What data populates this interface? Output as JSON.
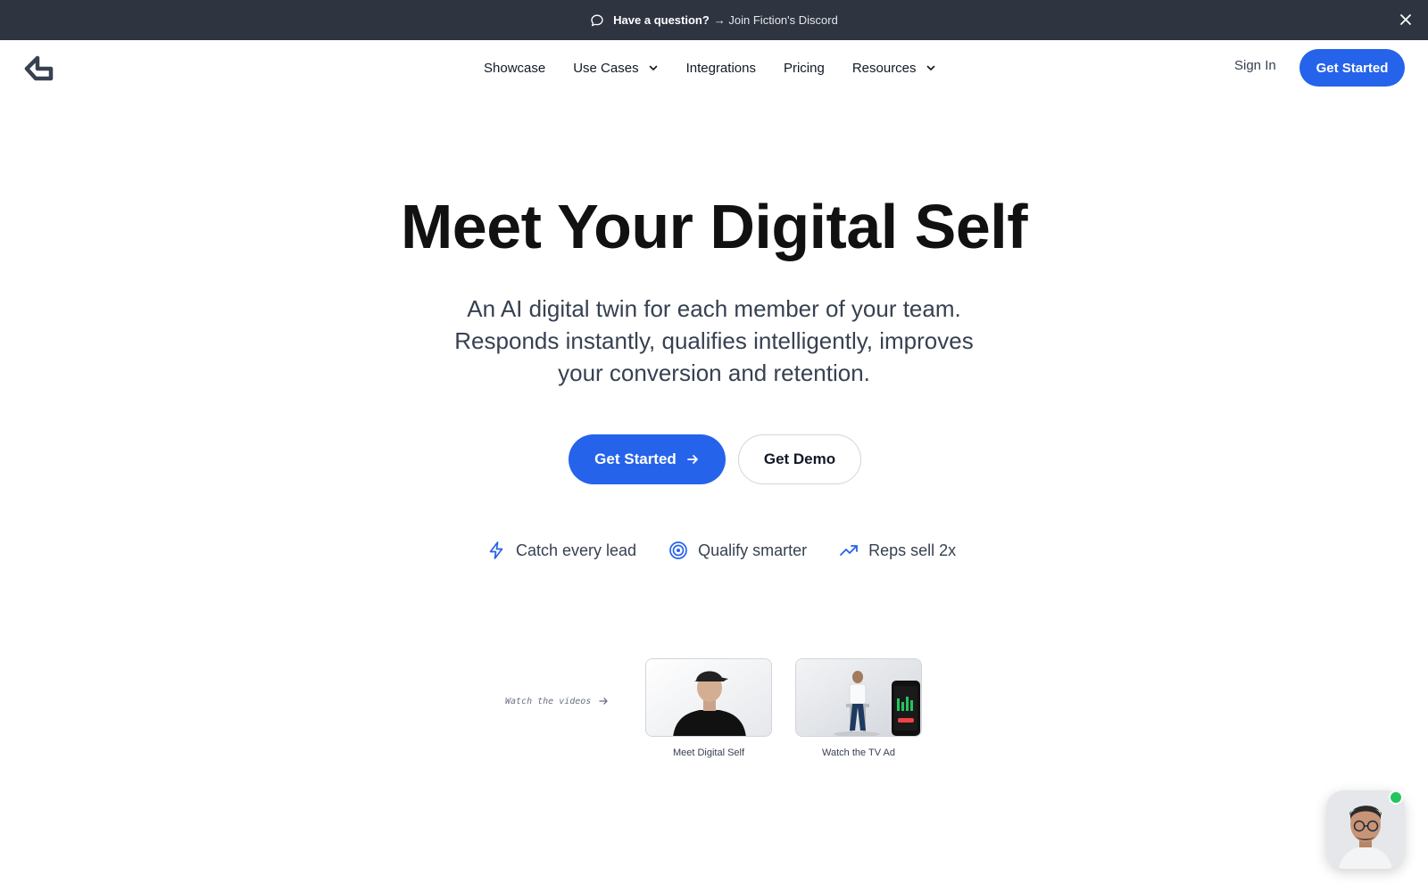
{
  "announcement": {
    "question": "Have a question?",
    "link_text": "→ Join Fiction's Discord",
    "icon": "chat-bubble-icon",
    "close_icon": "close-icon"
  },
  "nav": {
    "logo": "fiction-logo",
    "items": [
      {
        "label": "Showcase",
        "has_dropdown": false
      },
      {
        "label": "Use Cases",
        "has_dropdown": true
      },
      {
        "label": "Integrations",
        "has_dropdown": false
      },
      {
        "label": "Pricing",
        "has_dropdown": false
      },
      {
        "label": "Resources",
        "has_dropdown": true
      }
    ],
    "sign_in": "Sign In",
    "cta": "Get Started"
  },
  "hero": {
    "title": "Meet Your Digital Self",
    "subtitle_lines": [
      "An AI digital twin for each member of your team.",
      "Responds instantly, qualifies intelligently, improves",
      "your conversion and retention."
    ],
    "primary_cta": "Get Started",
    "secondary_cta": "Get Demo"
  },
  "features": [
    {
      "label": "Catch every lead",
      "icon": "lightning-icon"
    },
    {
      "label": "Qualify smarter",
      "icon": "target-icon"
    },
    {
      "label": "Reps sell 2x",
      "icon": "trending-up-icon"
    }
  ],
  "videos": {
    "prompt": "Watch the videos",
    "items": [
      {
        "caption": "Meet Digital Self"
      },
      {
        "caption": "Watch the TV Ad"
      }
    ]
  },
  "colors": {
    "accent": "#2563eb",
    "banner_bg": "#2f3441",
    "online": "#22c55e"
  }
}
